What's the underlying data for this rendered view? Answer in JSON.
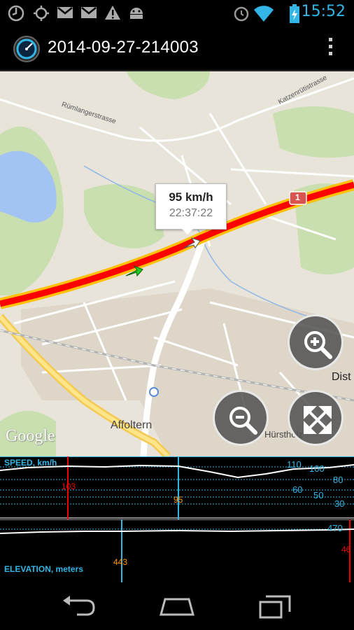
{
  "status_bar": {
    "time": "15:52",
    "icons": [
      "sync-icon",
      "gps-icon",
      "gmail-icon",
      "gmail-icon",
      "warning-icon",
      "android-icon",
      "alarm-icon",
      "wifi-icon",
      "battery-charging-icon"
    ]
  },
  "action_bar": {
    "title": "2014-09-27-214003",
    "app_icon": "speedometer-icon",
    "overflow_icon": "overflow-menu-icon"
  },
  "map": {
    "labels": {
      "street1": "Rümlangerstrasse",
      "street2": "Katzenrütistrasse",
      "town": "Affoltern",
      "hurstholz": "Hürstholz",
      "dist": "Dist",
      "route_shield": "1",
      "google": "Google"
    },
    "callout": {
      "speed": "95 km/h",
      "time": "22:37:22"
    },
    "controls": {
      "zoom_in": "zoom-in-icon",
      "zoom_out": "zoom-out-icon",
      "fit": "fit-bounds-icon"
    },
    "colors": {
      "track": "#ff0000",
      "track_edge": "#ffc107",
      "start": "#22cc22"
    }
  },
  "speed_chart": {
    "label": "SPEED, km/h",
    "ticks": [
      "110",
      "100",
      "80",
      "60",
      "50",
      "30"
    ],
    "marker_left": "103",
    "marker_cursor": "95",
    "color": "#33b5e5"
  },
  "elevation_chart": {
    "label": "ELEVATION, meters",
    "ticks": [
      "470"
    ],
    "marker_cursor": "443",
    "marker_right": "46",
    "color": "#33b5e5"
  },
  "nav_bar": {
    "icons": [
      "back-icon",
      "home-icon",
      "recent-apps-icon"
    ]
  }
}
